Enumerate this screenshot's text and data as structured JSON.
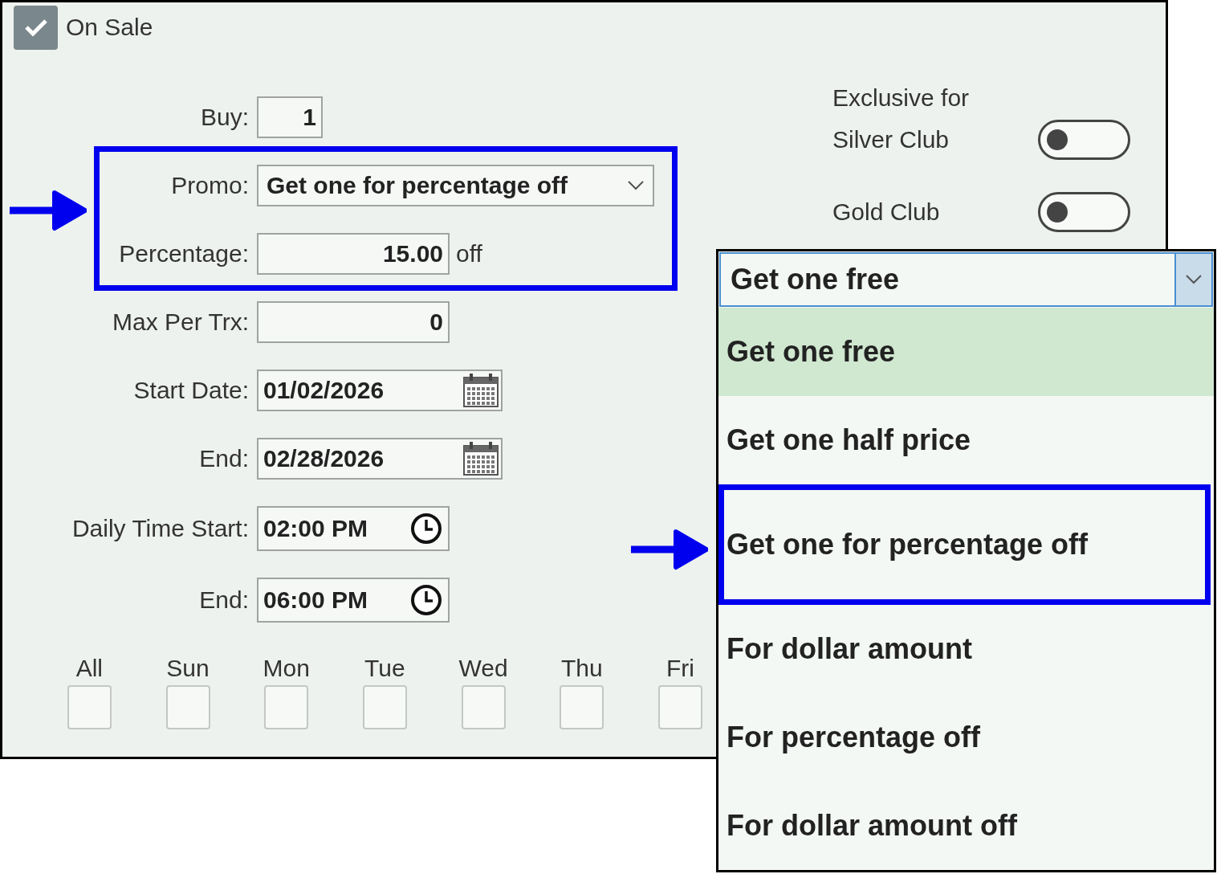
{
  "on_sale": {
    "label": "On Sale",
    "checked": true
  },
  "fields": [
    {
      "kind": "number",
      "label": "Buy:",
      "value": "1"
    },
    {
      "kind": "select",
      "label": "Promo:",
      "value": "Get one for percentage off"
    },
    {
      "kind": "number",
      "label": "Percentage:",
      "value": "15.00",
      "suffix": "off"
    },
    {
      "kind": "number",
      "label": "Max Per Trx:",
      "value": "0"
    },
    {
      "kind": "date",
      "label": "Start Date:",
      "value": "01/02/2026"
    },
    {
      "kind": "date",
      "label": "End:",
      "value": "02/28/2026"
    },
    {
      "kind": "time",
      "label": "Daily Time Start:",
      "value": "02:00 PM"
    },
    {
      "kind": "time",
      "label": "End:",
      "value": "06:00 PM"
    }
  ],
  "exclusive": {
    "title": "Exclusive for",
    "toggles": [
      {
        "label": "Silver Club",
        "on": false
      },
      {
        "label": "Gold Club",
        "on": false
      }
    ]
  },
  "days": [
    {
      "label": "All",
      "checked": false
    },
    {
      "label": "Sun",
      "checked": false
    },
    {
      "label": "Mon",
      "checked": false
    },
    {
      "label": "Tue",
      "checked": false
    },
    {
      "label": "Wed",
      "checked": false
    },
    {
      "label": "Thu",
      "checked": false
    },
    {
      "label": "Fri",
      "checked": false
    }
  ],
  "dropdown": {
    "value": "Get one free",
    "options": [
      {
        "label": "Get one free",
        "selected": true,
        "highlighted": false
      },
      {
        "label": "Get one half price",
        "selected": false,
        "highlighted": false
      },
      {
        "label": "Get one for percentage off",
        "selected": false,
        "highlighted": true
      },
      {
        "label": "For dollar amount",
        "selected": false,
        "highlighted": false
      },
      {
        "label": "For percentage off",
        "selected": false,
        "highlighted": false
      },
      {
        "label": "For dollar amount off",
        "selected": false,
        "highlighted": false
      }
    ]
  }
}
